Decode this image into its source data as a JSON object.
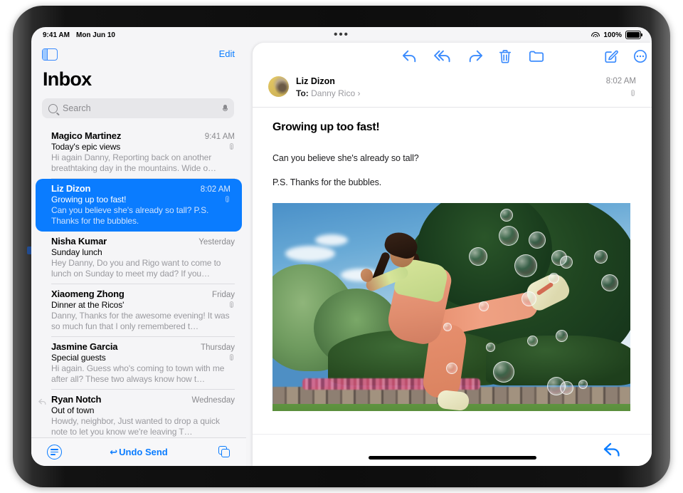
{
  "status_bar": {
    "time": "9:41 AM",
    "date": "Mon Jun 10",
    "multitask_dots": "•••",
    "wifi_icon": "wifi-icon",
    "battery_percent": "100%",
    "battery_icon": "battery-full-icon"
  },
  "list_pane": {
    "sidebar_toggle_icon": "sidebar-toggle-icon",
    "edit_label": "Edit",
    "title": "Inbox",
    "search": {
      "placeholder": "Search",
      "search_icon": "search-icon",
      "mic_icon": "microphone-icon"
    },
    "messages": [
      {
        "sender": "Magico Martinez",
        "time": "9:41 AM",
        "subject": "Today's epic views",
        "preview": "Hi again Danny, Reporting back on another breathtaking day in the mountains. Wide o…",
        "has_attachment": true,
        "replied": false,
        "selected": false
      },
      {
        "sender": "Liz Dizon",
        "time": "8:02 AM",
        "subject": "Growing up too fast!",
        "preview": "Can you believe she's already so tall? P.S. Thanks for the bubbles.",
        "has_attachment": true,
        "replied": false,
        "selected": true
      },
      {
        "sender": "Nisha Kumar",
        "time": "Yesterday",
        "subject": "Sunday lunch",
        "preview": "Hey Danny, Do you and Rigo want to come to lunch on Sunday to meet my dad? If you…",
        "has_attachment": false,
        "replied": false,
        "selected": false
      },
      {
        "sender": "Xiaomeng Zhong",
        "time": "Friday",
        "subject": "Dinner at the Ricos'",
        "preview": "Danny, Thanks for the awesome evening! It was so much fun that I only remembered t…",
        "has_attachment": true,
        "replied": false,
        "selected": false
      },
      {
        "sender": "Jasmine Garcia",
        "time": "Thursday",
        "subject": "Special guests",
        "preview": "Hi again. Guess who's coming to town with me after all? These two always know how t…",
        "has_attachment": true,
        "replied": false,
        "selected": false
      },
      {
        "sender": "Ryan Notch",
        "time": "Wednesday",
        "subject": "Out of town",
        "preview": "Howdy, neighbor, Just wanted to drop a quick note to let you know we're leaving T…",
        "has_attachment": false,
        "replied": true,
        "selected": false
      }
    ],
    "toolbar": {
      "filter_icon": "filter-icon",
      "undo_send_label": "Undo Send",
      "undo_arrow": "↩",
      "copy_icon": "duplicate-icon"
    }
  },
  "read_pane": {
    "toolbar": [
      {
        "name": "reply-button",
        "icon": "reply-icon"
      },
      {
        "name": "reply-all-button",
        "icon": "reply-all-icon"
      },
      {
        "name": "forward-button",
        "icon": "forward-icon"
      },
      {
        "name": "delete-button",
        "icon": "trash-icon"
      },
      {
        "name": "move-button",
        "icon": "folder-icon"
      },
      {
        "name": "compose-button",
        "icon": "compose-icon"
      },
      {
        "name": "more-button",
        "icon": "more-circle-icon"
      }
    ],
    "header": {
      "avatar_icon": "sender-avatar",
      "sender": "Liz Dizon",
      "to_label": "To:",
      "recipient": "Danny Rico",
      "disclosure": "›",
      "time": "8:02 AM",
      "attachment_icon": "paperclip-icon"
    },
    "message": {
      "subject": "Growing up too fast!",
      "paragraph1": "Can you believe she's already so tall?",
      "paragraph2": "P.S. Thanks for the bubbles.",
      "photo_alt": "girl-leaping-with-bubbles-photo"
    },
    "bottom": {
      "reply_icon": "reply-icon"
    }
  },
  "colors": {
    "accent_blue": "#0a7cff",
    "selected_row": "#0a7cff",
    "list_background": "#f5f5f7",
    "pane_background": "#ffffff"
  }
}
